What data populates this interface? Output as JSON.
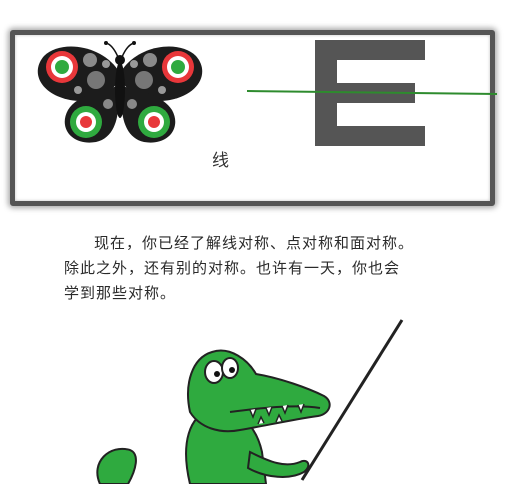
{
  "figure": {
    "label": "线"
  },
  "paragraph": {
    "lines": [
      "现在，你已经了解线对称、点对称和面对称。",
      "除此之外，还有别的对称。也许有一天，你也会",
      "学到那些对称。"
    ]
  },
  "colors": {
    "frame_border": "#555555",
    "butterfly_wing": "#1c1c1c",
    "butterfly_red": "#e8373a",
    "butterfly_green": "#2faa3f",
    "letter_gray": "#555555",
    "symmetry_line": "#2e8b2e",
    "croc_green": "#2faa3f"
  }
}
